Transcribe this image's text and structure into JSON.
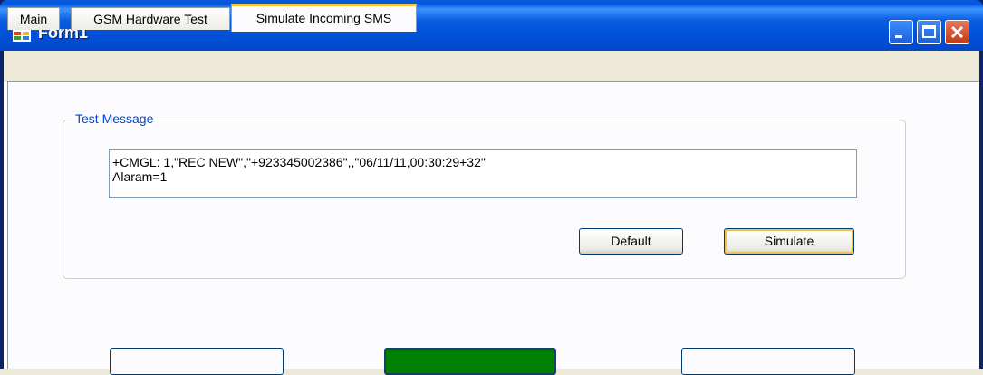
{
  "window": {
    "title": "Form1",
    "icon": "app-form-icon",
    "controls": [
      "minimize-icon",
      "maximize-icon",
      "close-icon"
    ]
  },
  "tabs": [
    {
      "label": "Main",
      "active": false
    },
    {
      "label": "GSM Hardware Test",
      "active": false
    },
    {
      "label": "Simulate Incoming SMS",
      "active": true
    }
  ],
  "test_message": {
    "group_label": "Test Message",
    "value": "+CMGL: 1,\"REC NEW\",\"+923345002386\",,\"06/11/11,00:30:29+32\"\nAlaram=1"
  },
  "buttons": {
    "default_label": "Default",
    "simulate_label": "Simulate"
  },
  "bottom_buttons": [
    {
      "label": "",
      "color": "#fcfcfe"
    },
    {
      "label": "",
      "color": "#008000"
    },
    {
      "label": "",
      "color": "#fcfcfe"
    }
  ],
  "colors": {
    "titlebar": "#0058e6",
    "group_label": "#0046d5",
    "active_tab_highlight": "#ffc83c",
    "indicator_green": "#008000"
  }
}
